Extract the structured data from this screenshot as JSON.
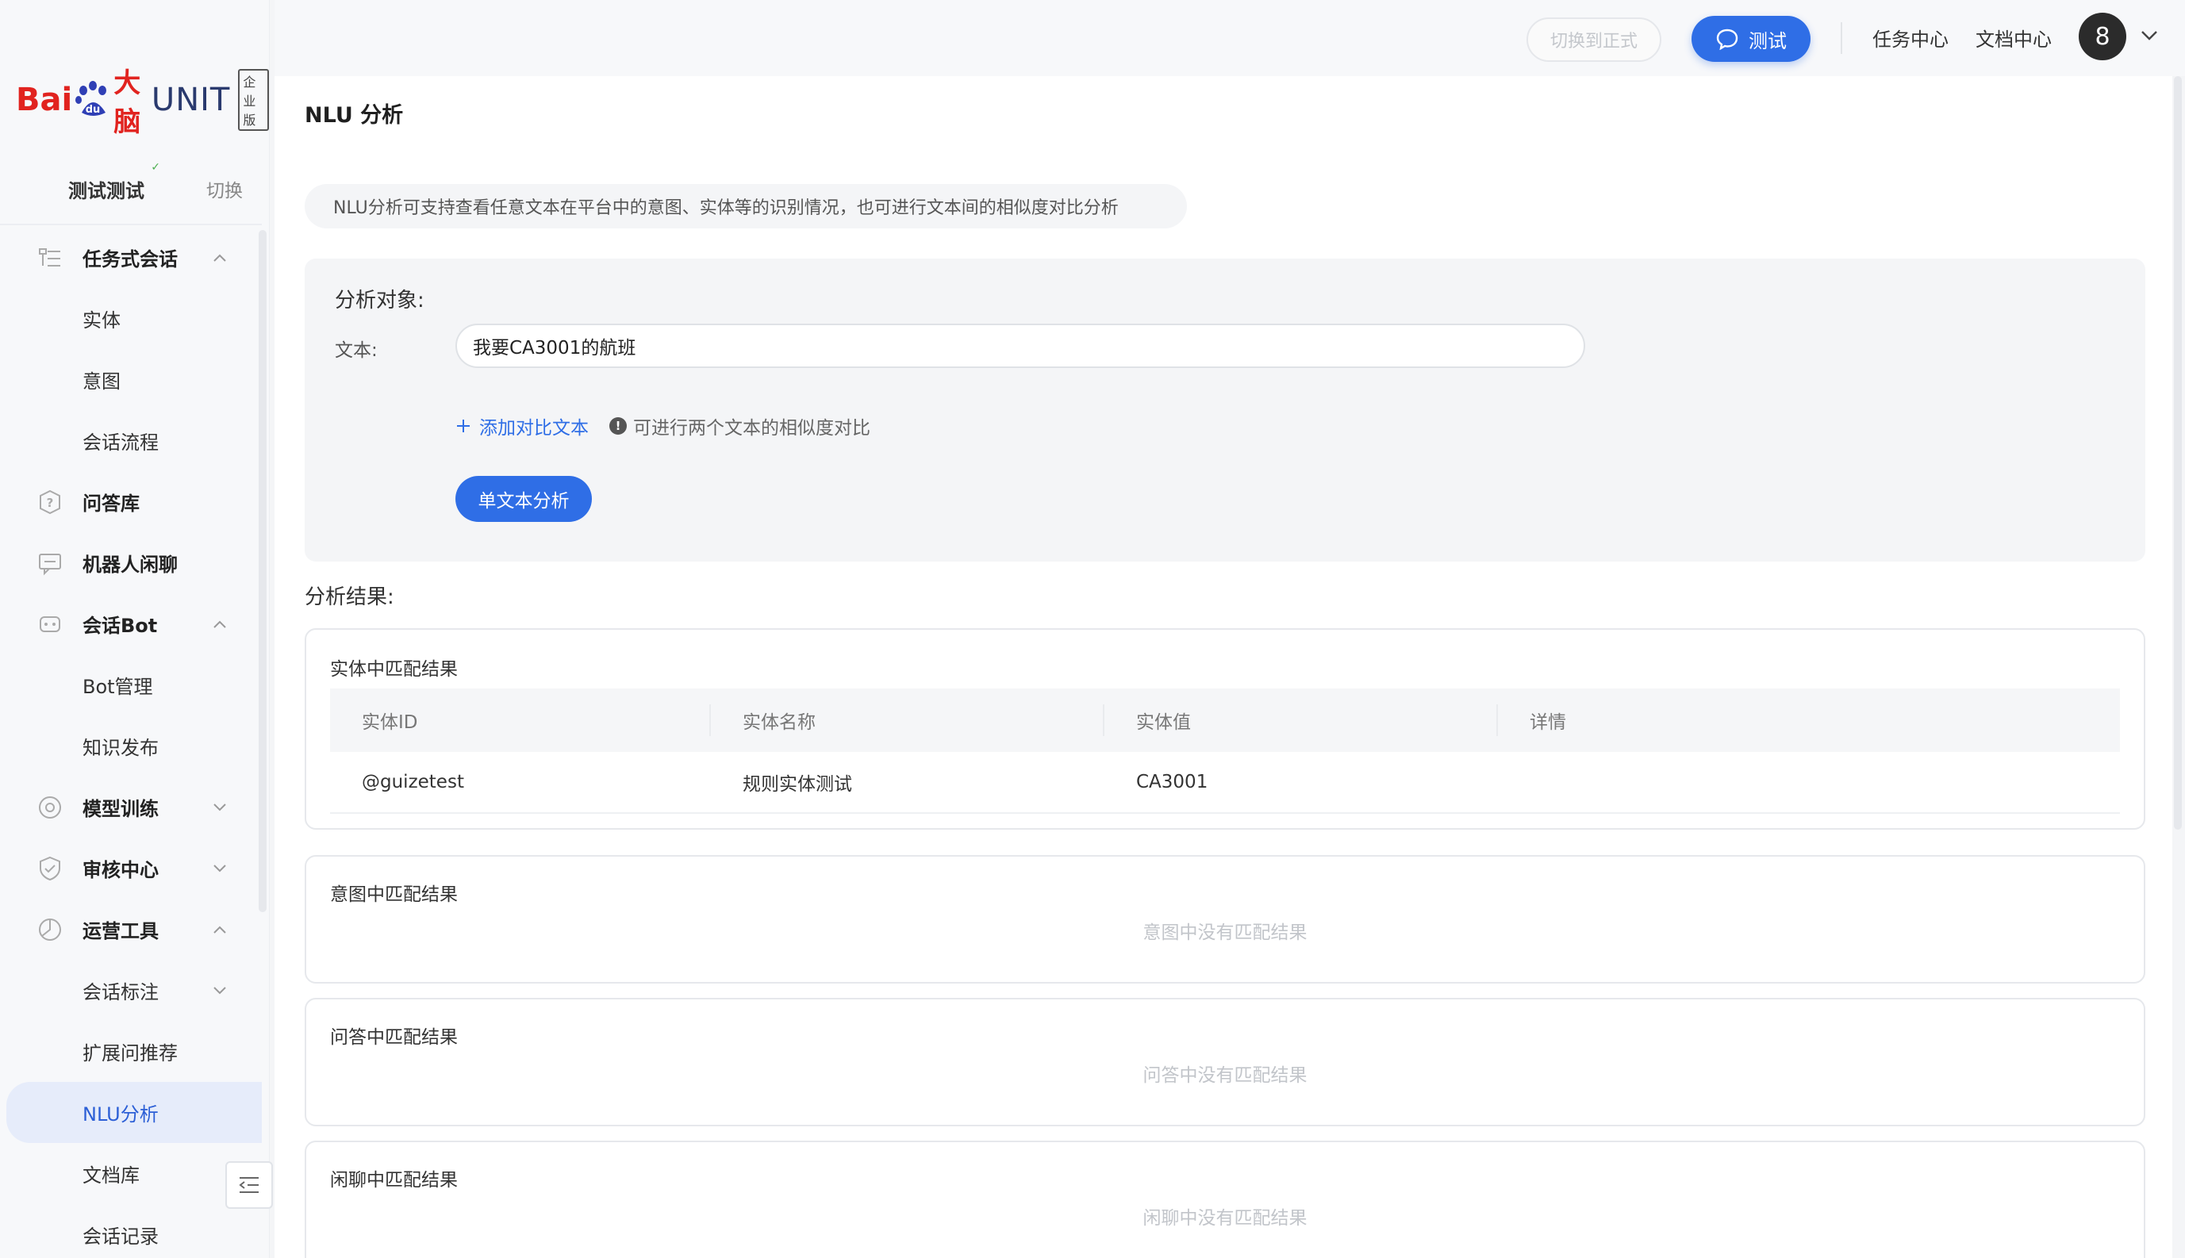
{
  "brand": {
    "bai": "Bai",
    "du": "du",
    "dana": "大脑",
    "unit": "UNIT",
    "edition": "企业版"
  },
  "space": {
    "name": "测试测试",
    "switch_label": "切换"
  },
  "sidebar": {
    "items": [
      {
        "label": "任务式会话",
        "type": "group",
        "icon": "task-dialog-icon",
        "chevron": "up"
      },
      {
        "label": "实体",
        "type": "sub"
      },
      {
        "label": "意图",
        "type": "sub"
      },
      {
        "label": "会话流程",
        "type": "sub"
      },
      {
        "label": "问答库",
        "type": "group",
        "icon": "qa-library-icon"
      },
      {
        "label": "机器人闲聊",
        "type": "group",
        "icon": "chat-icon"
      },
      {
        "label": "会话Bot",
        "type": "group",
        "icon": "bot-icon",
        "chevron": "up"
      },
      {
        "label": "Bot管理",
        "type": "sub"
      },
      {
        "label": "知识发布",
        "type": "sub"
      },
      {
        "label": "模型训练",
        "type": "group",
        "icon": "training-icon",
        "chevron": "down"
      },
      {
        "label": "审核中心",
        "type": "group",
        "icon": "shield-icon",
        "chevron": "down"
      },
      {
        "label": "运营工具",
        "type": "group",
        "icon": "chart-icon",
        "chevron": "up"
      },
      {
        "label": "会话标注",
        "type": "sub",
        "chevron": "down"
      },
      {
        "label": "扩展问推荐",
        "type": "sub"
      },
      {
        "label": "NLU分析",
        "type": "sub",
        "active": true
      },
      {
        "label": "文档库",
        "type": "sub"
      },
      {
        "label": "会话记录",
        "type": "sub"
      }
    ]
  },
  "topbar": {
    "switch_env": "切换到正式",
    "test_button": "测试",
    "task_center": "任务中心",
    "doc_center": "文档中心",
    "avatar_text": "8"
  },
  "page": {
    "title": "NLU 分析",
    "tip": "NLU分析可支持查看任意文本在平台中的意图、实体等的识别情况，也可进行文本间的相似度对比分析"
  },
  "analysis": {
    "section_label": "分析对象:",
    "text_label": "文本:",
    "text_value": "我要CA3001的航班",
    "add_compare": "添加对比文本",
    "hint": "可进行两个文本的相似度对比",
    "analyze_button": "单文本分析"
  },
  "results": {
    "section_label": "分析结果:",
    "entity": {
      "title": "实体中匹配结果",
      "columns": [
        "实体ID",
        "实体名称",
        "实体值",
        "详情"
      ],
      "rows": [
        [
          "@guizetest",
          "规则实体测试",
          "CA3001",
          ""
        ]
      ]
    },
    "intent": {
      "title": "意图中匹配结果",
      "empty": "意图中没有匹配结果"
    },
    "qa": {
      "title": "问答中匹配结果",
      "empty": "问答中没有匹配结果"
    },
    "chitchat": {
      "title": "闲聊中匹配结果",
      "empty": "闲聊中没有匹配结果"
    }
  },
  "colors": {
    "primary": "#2f6ee6",
    "brand_red": "#e1231f",
    "active_bg": "#e6ecfa"
  }
}
